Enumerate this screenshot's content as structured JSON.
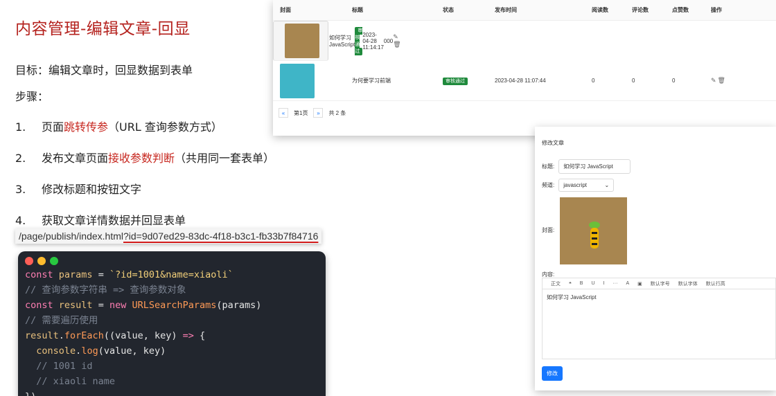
{
  "title": "内容管理-编辑文章-回显",
  "goal": "目标：编辑文章时，回显数据到表单",
  "steps_label": "步骤：",
  "steps": [
    {
      "num": "1.",
      "pre": "页面",
      "red": "跳转传参",
      "post": "（URL 查询参数方式）"
    },
    {
      "num": "2.",
      "pre": "发布文章页面",
      "red": "接收参数判断",
      "post": "（共用同一套表单）"
    },
    {
      "num": "3.",
      "pre": "修改标题和按钮文字",
      "red": "",
      "post": ""
    },
    {
      "num": "4.",
      "pre": "获取文章详情数据并回显表单",
      "red": "",
      "post": ""
    }
  ],
  "url": {
    "path": "/page/publish/index.html",
    "query": "?id=9d07ed29-83dc-4f18-b3c1-fb33b7f84716"
  },
  "code": [
    {
      "parts": [
        [
          "kw",
          "const "
        ],
        [
          "id",
          "params"
        ],
        [
          "pl",
          " = "
        ],
        [
          "str",
          "`?id=1001&name=xiaoli`"
        ]
      ]
    },
    {
      "parts": [
        [
          "cm",
          "// 查询参数字符串 => 查询参数对象"
        ]
      ]
    },
    {
      "parts": [
        [
          "kw",
          "const "
        ],
        [
          "id",
          "result"
        ],
        [
          "pl",
          " = "
        ],
        [
          "kw",
          "new "
        ],
        [
          "fn",
          "URLSearchParams"
        ],
        [
          "pl",
          "(params)"
        ]
      ]
    },
    {
      "parts": [
        [
          "cm",
          "// 需要遍历使用"
        ]
      ]
    },
    {
      "parts": [
        [
          "id",
          "result"
        ],
        [
          "pl",
          "."
        ],
        [
          "fn",
          "forEach"
        ],
        [
          "pl",
          "((value, key) "
        ],
        [
          "kw",
          "=>"
        ],
        [
          "pl",
          " {"
        ]
      ]
    },
    {
      "parts": [
        [
          "pl",
          "  "
        ],
        [
          "id",
          "console"
        ],
        [
          "pl",
          "."
        ],
        [
          "fn",
          "log"
        ],
        [
          "pl",
          "(value, key)"
        ]
      ]
    },
    {
      "parts": [
        [
          "cm",
          "  // 1001 id"
        ]
      ]
    },
    {
      "parts": [
        [
          "cm",
          "  // xiaoli name"
        ]
      ]
    },
    {
      "parts": [
        [
          "pl",
          "})"
        ]
      ]
    }
  ],
  "table": {
    "headers": [
      "封面",
      "标题",
      "状态",
      "发布时间",
      "阅读数",
      "评论数",
      "点赞数",
      "操作"
    ],
    "rows": [
      {
        "title": "如何学习 JavaScript",
        "status": "审核通过",
        "time": "2023-04-28 11:14:17",
        "read": "0",
        "comment": "0",
        "like": "0",
        "cover": "#a88650"
      },
      {
        "title": "为何要学习前端",
        "status": "审核通过",
        "time": "2023-04-28 11:07:44",
        "read": "0",
        "comment": "0",
        "like": "0",
        "cover": "#3fb5c7"
      }
    ],
    "pager": {
      "prev": "«",
      "page": "第1页",
      "next": "»",
      "total": "共 2 条"
    }
  },
  "form": {
    "title": "修改文章",
    "title_label": "标题:",
    "title_value": "如何学习 JavaScript",
    "channel_label": "频道:",
    "channel_value": "javascript",
    "cover_label": "封面:",
    "content_label": "内容:",
    "toolbar": [
      "正文",
      "❝",
      "B",
      "U",
      "I",
      "···",
      "A",
      "▣",
      "默认字号",
      "默认字体",
      "默认行高"
    ],
    "content": "如何学习 JavaScript",
    "submit": "修改"
  },
  "colors": {
    "accent": "#1677ff",
    "title_red": "#b5231f",
    "badge": "#1f8a3c"
  }
}
